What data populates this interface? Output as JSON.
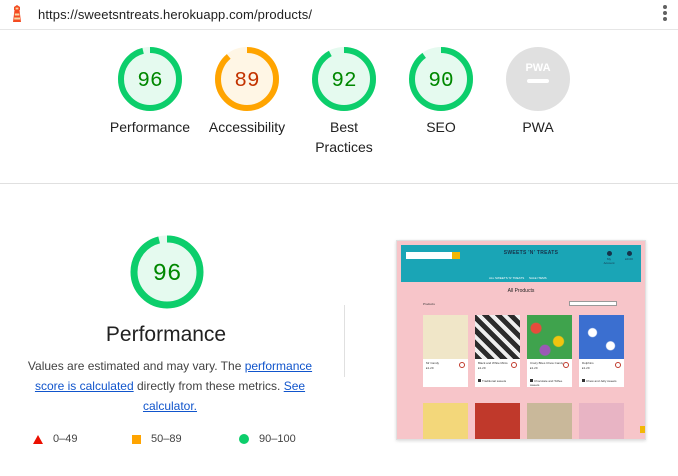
{
  "topbar": {
    "url": "https://sweetsntreats.herokuapp.com/products/",
    "logo_icon": "lighthouse-icon",
    "menu_icon": "kebab-menu-icon"
  },
  "colors": {
    "pass": "#0cce6b",
    "pass_text": "#008800",
    "pass_fill": "#e5faef",
    "average": "#ffa400",
    "average_text": "#c33300",
    "average_fill": "#fff6e5",
    "fail": "#eb0f00",
    "na": "#cccccc"
  },
  "categories": [
    {
      "id": "performance",
      "score": "96",
      "value": 96,
      "label": "Performance",
      "status": "pass"
    },
    {
      "id": "accessibility",
      "score": "89",
      "value": 89,
      "label": "Accessibility",
      "status": "average"
    },
    {
      "id": "best-practices",
      "score": "92",
      "value": 92,
      "label": "Best Practices",
      "status": "pass"
    },
    {
      "id": "seo",
      "score": "90",
      "value": 90,
      "label": "SEO",
      "status": "pass"
    },
    {
      "id": "pwa",
      "score": "",
      "value": null,
      "label": "PWA",
      "status": "na",
      "badge": "PWA"
    }
  ],
  "performance": {
    "score": "96",
    "value": 96,
    "title": "Performance",
    "desc_prefix": "Values are estimated and may vary. The ",
    "desc_link1": "performance score is calculated",
    "desc_middle": " directly from these metrics. ",
    "desc_link2": "See calculator."
  },
  "legend": [
    {
      "shape": "triangle",
      "range": "0–49"
    },
    {
      "shape": "square",
      "range": "50–89"
    },
    {
      "shape": "circle",
      "range": "90–100"
    }
  ],
  "screenshot": {
    "brand": "SWEETS 'N' TREATS",
    "nav": [
      "ALL SWEETS 'N' TREATS",
      "SALE ITEMS"
    ],
    "account_label": "My Account",
    "cart_label": "£0.00",
    "page_title": "All Products",
    "products_label": "Products",
    "cards": [
      {
        "name": "Mr Candy",
        "price": "£1.29",
        "tag": "",
        "image_color": "#f0e6c8"
      },
      {
        "name": "Black and White Mints",
        "price": "£1.29",
        "tag": "Traditional sweets",
        "image_color": "#8a8a8a"
      },
      {
        "name": "Crazy Bites Chew Candy",
        "price": "£1.29",
        "tag": "Chocolate and Toffee sweets",
        "image_color": "#3fa34d"
      },
      {
        "name": "Dolphins",
        "price": "£1.29",
        "tag": "Chew and Jelly sweets",
        "image_color": "#3b6fd0"
      }
    ],
    "row2_colors": [
      "#f3d77a",
      "#c0392b",
      "#c9b89a",
      "#e8b4c4"
    ]
  }
}
